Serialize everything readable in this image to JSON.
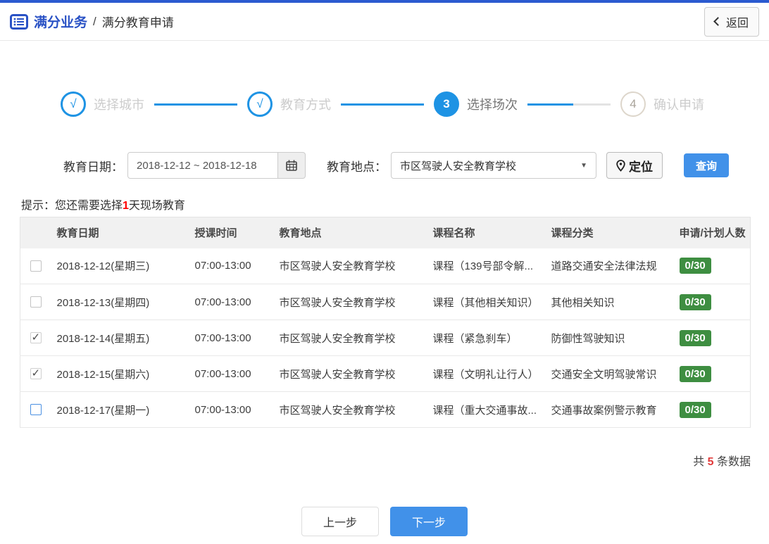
{
  "header": {
    "breadcrumb_section": "满分业务",
    "breadcrumb_separator": "/",
    "breadcrumb_page": "满分教育申请",
    "back_button": "返回"
  },
  "stepper": {
    "steps": [
      {
        "marker": "√",
        "label": "选择城市",
        "done": true
      },
      {
        "marker": "√",
        "label": "教育方式",
        "done": true
      },
      {
        "marker": "3",
        "label": "选择场次",
        "active": true
      },
      {
        "marker": "4",
        "label": "确认申请",
        "pending": true
      }
    ]
  },
  "filters": {
    "date_label": "教育日期：",
    "date_value": "2018-12-12 ~ 2018-12-18",
    "location_label": "教育地点：",
    "location_value": "市区驾驶人安全教育学校",
    "dropdown_arrow": "▼",
    "locate_button": "定位",
    "search_button": "查询"
  },
  "hint": {
    "prefix": "提示：您还需要选择",
    "highlight": "1",
    "suffix": "天现场教育"
  },
  "table": {
    "columns": [
      "教育日期",
      "授课时间",
      "教育地点",
      "课程名称",
      "课程分类",
      "申请/计划人数"
    ],
    "check_mark": "✓",
    "rows": [
      {
        "checked": false,
        "date": "2018-12-12(星期三)",
        "time": "07:00-13:00",
        "location": "市区驾驶人安全教育学校",
        "course": "课程（139号部令解...",
        "category": "道路交通安全法律法规",
        "count": "0/30"
      },
      {
        "checked": false,
        "date": "2018-12-13(星期四)",
        "time": "07:00-13:00",
        "location": "市区驾驶人安全教育学校",
        "course": "课程（其他相关知识）",
        "category": "其他相关知识",
        "count": "0/30"
      },
      {
        "checked": true,
        "date": "2018-12-14(星期五)",
        "time": "07:00-13:00",
        "location": "市区驾驶人安全教育学校",
        "course": "课程（紧急刹车）",
        "category": "防御性驾驶知识",
        "count": "0/30"
      },
      {
        "checked": true,
        "date": "2018-12-15(星期六)",
        "time": "07:00-13:00",
        "location": "市区驾驶人安全教育学校",
        "course": "课程（文明礼让行人）",
        "category": "交通安全文明驾驶常识",
        "count": "0/30"
      },
      {
        "checked": false,
        "focused": true,
        "date": "2018-12-17(星期一)",
        "time": "07:00-13:00",
        "location": "市区驾驶人安全教育学校",
        "course": "课程（重大交通事故...",
        "category": "交通事故案例警示教育",
        "count": "0/30"
      }
    ]
  },
  "summary": {
    "prefix": "共 ",
    "count": "5",
    "suffix": " 条数据"
  },
  "footer": {
    "prev_button": "上一步",
    "next_button": "下一步"
  },
  "colors": {
    "topbar_blue": "#2b5ad0",
    "breadcrumb_blue": "#2a52c5",
    "stepper_blue": "#1e93e4",
    "primary_button_blue": "#4191e9",
    "badge_green": "#3e8e41",
    "highlight_red": "#f00"
  }
}
